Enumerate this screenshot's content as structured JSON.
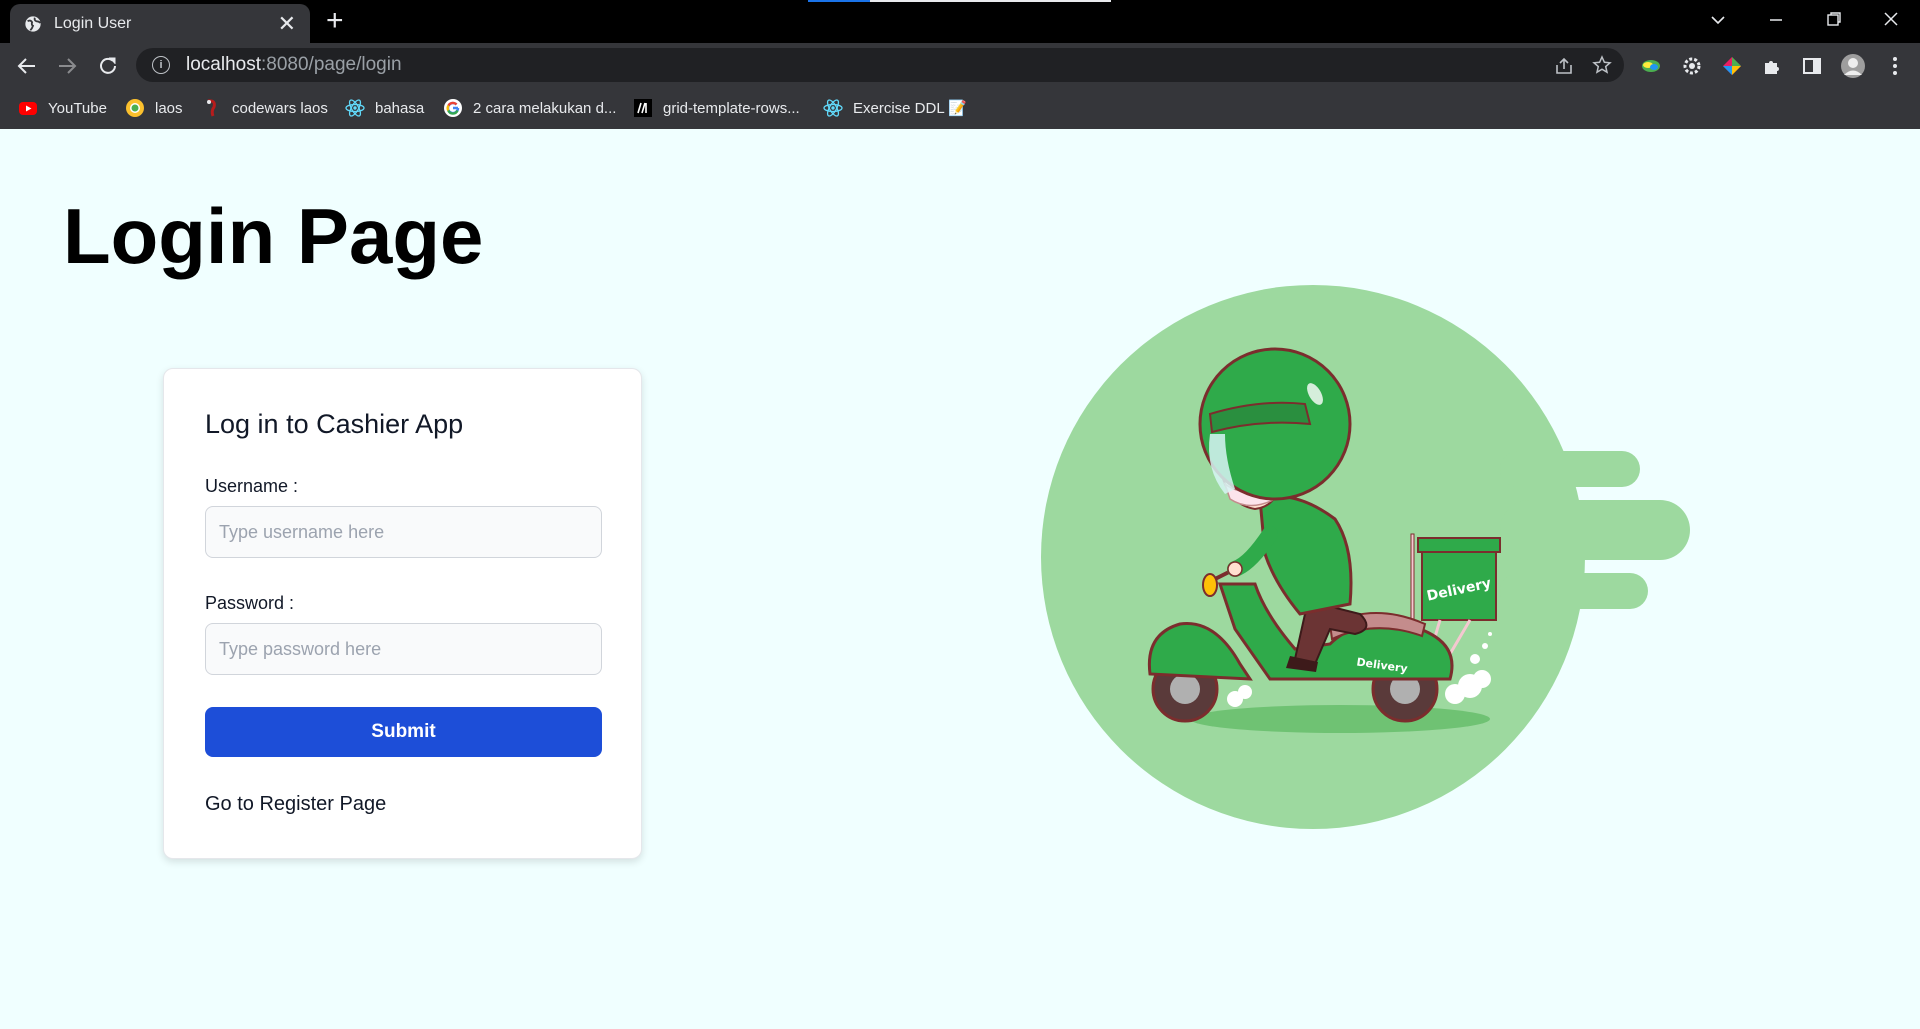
{
  "browser": {
    "tab_title": "Login User",
    "new_tab_symbol": "+",
    "tab_close_symbol": "✕",
    "url_host": "localhost",
    "url_path": ":8080/page/login",
    "bookmarks": [
      {
        "label": "YouTube",
        "icon": "youtube-icon"
      },
      {
        "label": "laos",
        "icon": "chrome-icon"
      },
      {
        "label": "codewars laos",
        "icon": "codewars-icon"
      },
      {
        "label": "bahasa",
        "icon": "react-icon"
      },
      {
        "label": "2 cara melakukan d...",
        "icon": "google-icon"
      },
      {
        "label": "grid-template-rows...",
        "icon": "mdn-icon"
      },
      {
        "label": "Exercise DDL 📝",
        "icon": "react-icon"
      }
    ]
  },
  "page": {
    "title": "Login Page",
    "card": {
      "heading": "Log in to Cashier App",
      "username_label": "Username :",
      "username_placeholder": "Type username here",
      "username_value": "",
      "password_label": "Password :",
      "password_placeholder": "Type password here",
      "password_value": "",
      "submit_label": "Submit",
      "register_link": "Go to Register Page"
    },
    "illustration": {
      "box_label": "Delivery",
      "scooter_label": "Delivery"
    }
  },
  "colors": {
    "page_bg": "#f0ffff",
    "primary_button": "#1d4ed8",
    "illustration_circle": "#9dd99f",
    "scooter_green": "#2faa4a"
  }
}
